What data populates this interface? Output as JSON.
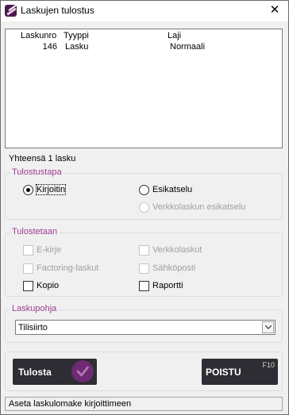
{
  "window": {
    "title": "Laskujen tulostus",
    "close_glyph": "✕"
  },
  "invoices": {
    "columns": [
      "Laskunro",
      "Tyyppi",
      "Laji"
    ],
    "rows": [
      {
        "number": "146",
        "type": "Lasku",
        "kind": "Normaali"
      }
    ],
    "summary": "Yhteensä 1 lasku"
  },
  "print_method": {
    "legend": "Tulostustapa",
    "options": [
      {
        "label": "Kirjoitin",
        "selected": true,
        "enabled": true
      },
      {
        "label": "Esikatselu",
        "selected": false,
        "enabled": true
      },
      {
        "label": "Verkkolaskun esikatselu",
        "selected": false,
        "enabled": false
      }
    ]
  },
  "print_targets": {
    "legend": "Tulostetaan",
    "options": [
      {
        "label": "E-kirje",
        "checked": false,
        "enabled": false
      },
      {
        "label": "Verkkolaskut",
        "checked": false,
        "enabled": false
      },
      {
        "label": "Factoring-laskut",
        "checked": false,
        "enabled": false
      },
      {
        "label": "Sähköposti",
        "checked": false,
        "enabled": false
      },
      {
        "label": "Kopio",
        "checked": false,
        "enabled": true
      },
      {
        "label": "Raportti",
        "checked": false,
        "enabled": true
      }
    ]
  },
  "template": {
    "legend": "Laskupohja",
    "selected": "Tilisiirto"
  },
  "buttons": {
    "print": {
      "label": "Tulosta",
      "icon": "check-circle-icon",
      "color": "#6e2a72"
    },
    "remove": {
      "label": "POISTU",
      "shortcut": "F10"
    }
  },
  "status": "Aseta laskulomake kirjoittimeen",
  "colors": {
    "accent": "#9c3d8f",
    "button_bg": "#2d2d33"
  }
}
